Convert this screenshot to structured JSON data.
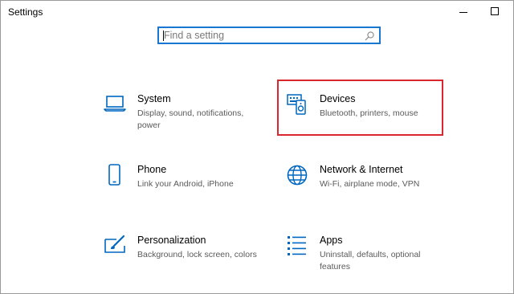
{
  "window": {
    "title": "Settings"
  },
  "search": {
    "placeholder": "Find a setting",
    "value": ""
  },
  "categories": [
    {
      "name": "System",
      "description": "Display, sound, notifications, power",
      "icon": "laptop-icon"
    },
    {
      "name": "Devices",
      "description": "Bluetooth, printers, mouse",
      "icon": "devices-icon"
    },
    {
      "name": "Phone",
      "description": "Link your Android, iPhone",
      "icon": "phone-icon"
    },
    {
      "name": "Network & Internet",
      "description": "Wi-Fi, airplane mode, VPN",
      "icon": "globe-icon"
    },
    {
      "name": "Personalization",
      "description": "Background, lock screen, colors",
      "icon": "paintbrush-icon"
    },
    {
      "name": "Apps",
      "description": "Uninstall, defaults, optional features",
      "icon": "apps-list-icon"
    }
  ],
  "colors": {
    "accent": "#0067c0",
    "search_border": "#1976d2",
    "highlight": "#d9262f",
    "description_text": "#5a5a5a"
  }
}
